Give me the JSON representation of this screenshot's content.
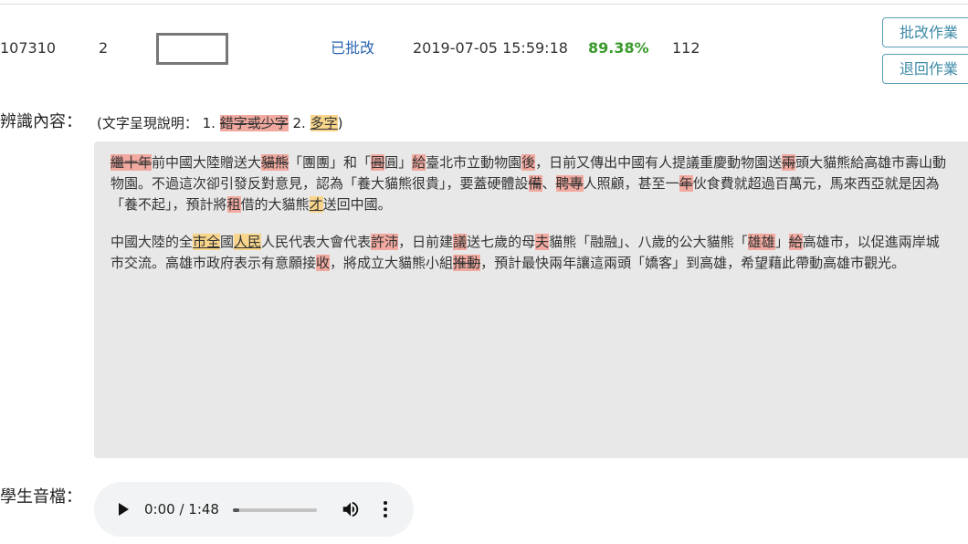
{
  "record": {
    "id": "107310",
    "number": "2",
    "status": "已批改",
    "timestamp": "2019-07-05 15:59:18",
    "score": "89.38%",
    "count": "112"
  },
  "buttons": {
    "grade": "批改作業",
    "return": "退回作業"
  },
  "recognition": {
    "label": "辨識內容：",
    "legend_prefix": "(文字呈現說明： 1.",
    "legend_error": "錯字或少字",
    "legend_mid": "2.",
    "legend_extra": "多字",
    "legend_suffix": ")",
    "paragraphs": [
      [
        {
          "t": "繼十年",
          "c": "err"
        },
        {
          "t": "前中國大陸贈送大",
          "c": ""
        },
        {
          "t": "貓熊",
          "c": "err"
        },
        {
          "t": "「團團」和「",
          "c": ""
        },
        {
          "t": "圓",
          "c": "err"
        },
        {
          "t": "圓」",
          "c": ""
        },
        {
          "t": "給",
          "c": "mis"
        },
        {
          "t": "臺北市立動物園",
          "c": ""
        },
        {
          "t": "後",
          "c": "mis"
        },
        {
          "t": "，日前又傳出中國有人提議重慶動物園送",
          "c": ""
        },
        {
          "t": "兩",
          "c": "err"
        },
        {
          "t": "頭大貓熊給高雄市壽山動物園。不過這次卻引發反對意見，認為「養大貓熊很貴」，要蓋硬體設",
          "c": ""
        },
        {
          "t": "備",
          "c": "err"
        },
        {
          "t": "、",
          "c": ""
        },
        {
          "t": "聘專",
          "c": "err"
        },
        {
          "t": "人照顧，甚至一",
          "c": ""
        },
        {
          "t": "年",
          "c": "err"
        },
        {
          "t": "伙食費就超過百萬元，馬來西亞就是因為「養不起」，預計將",
          "c": ""
        },
        {
          "t": "租",
          "c": "mis"
        },
        {
          "t": "借的大貓熊",
          "c": ""
        },
        {
          "t": "才",
          "c": "extra"
        },
        {
          "t": "送回中國。",
          "c": ""
        }
      ],
      [
        {
          "t": "中國大陸的全",
          "c": ""
        },
        {
          "t": "市全",
          "c": "extra"
        },
        {
          "t": "國",
          "c": ""
        },
        {
          "t": "人民",
          "c": "extra"
        },
        {
          "t": "人民代表大會代表",
          "c": ""
        },
        {
          "t": "許沛",
          "c": "mis"
        },
        {
          "t": "，日前建",
          "c": ""
        },
        {
          "t": "議",
          "c": "mis"
        },
        {
          "t": "送七歲的母",
          "c": ""
        },
        {
          "t": "夫",
          "c": "mis"
        },
        {
          "t": "貓熊「融融」、八歲的公大貓熊「",
          "c": ""
        },
        {
          "t": "雄雄",
          "c": "mis"
        },
        {
          "t": "」",
          "c": ""
        },
        {
          "t": "給",
          "c": "err"
        },
        {
          "t": "高雄市，以促進兩岸城市交流。高雄市政府表示有意願接",
          "c": ""
        },
        {
          "t": "收",
          "c": "mis"
        },
        {
          "t": "，將成立大貓熊小組",
          "c": ""
        },
        {
          "t": "推動",
          "c": "err"
        },
        {
          "t": "，預計最快兩年讓這兩頭「嬌客」到高雄，希望藉此帶動高雄市觀光。",
          "c": ""
        }
      ]
    ]
  },
  "audio": {
    "label": "學生音檔：",
    "time": "0:00 / 1:48",
    "progress": 0.08,
    "icons": [
      "play-icon",
      "volume-icon",
      "more-options-icon"
    ]
  },
  "colors": {
    "error_highlight": "#f1a9a0",
    "extra_highlight": "#f8d58b",
    "status_blue": "#2a64b0",
    "score_green": "#3a9a2c",
    "button_border": "#5a9fb7",
    "content_bg": "#e8e8e8"
  }
}
